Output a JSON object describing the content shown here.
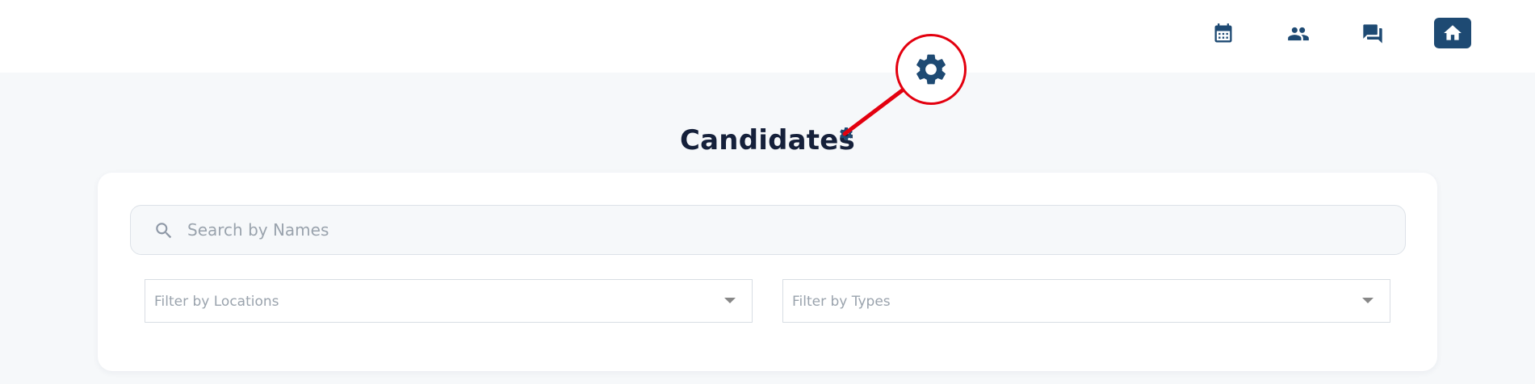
{
  "topbar": {
    "icons": [
      {
        "name": "calendar-icon"
      },
      {
        "name": "people-icon"
      },
      {
        "name": "chat-icon"
      },
      {
        "name": "home-icon"
      }
    ],
    "accent_color": "#1e4a73"
  },
  "page": {
    "title": "Candidates",
    "settings_icon": "gear-icon"
  },
  "annotation": {
    "color": "#e3000f",
    "icon": "gear-icon"
  },
  "search": {
    "placeholder": "Search by Names",
    "value": ""
  },
  "filters": {
    "locations": {
      "placeholder": "Filter by Locations"
    },
    "types": {
      "placeholder": "Filter by Types"
    }
  }
}
